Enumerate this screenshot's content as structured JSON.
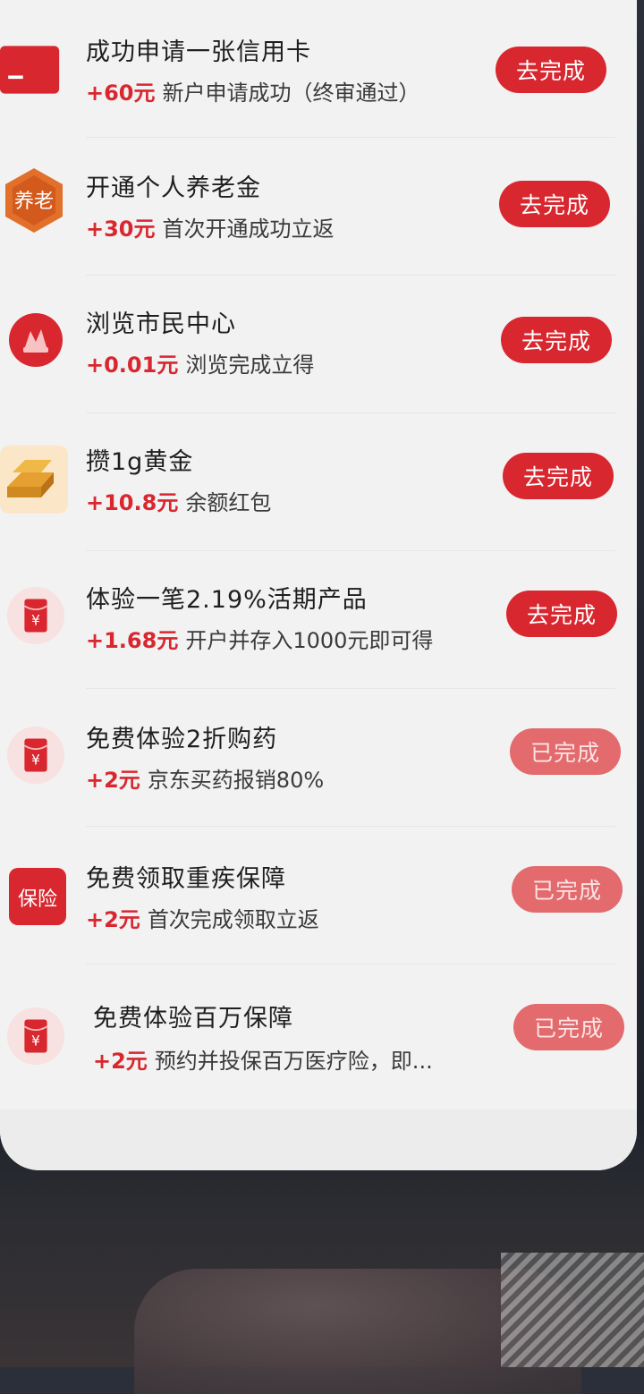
{
  "tasks": [
    {
      "title": "成功申请一张信用卡",
      "reward": "+60元",
      "desc": "新户申请成功（终审通过）",
      "action": "去完成",
      "done": false,
      "icon": "credit-card-icon"
    },
    {
      "title": "开通个人养老金",
      "reward": "+30元",
      "desc": "首次开通成功立返",
      "action": "去完成",
      "done": false,
      "icon": "pension-icon",
      "icon_text": "养老"
    },
    {
      "title": "浏览市民中心",
      "reward": "+0.01元",
      "desc": "浏览完成立得",
      "action": "去完成",
      "done": false,
      "icon": "citizen-center-icon"
    },
    {
      "title": "攒1g黄金",
      "reward": "+10.8元",
      "desc": "余额红包",
      "action": "去完成",
      "done": false,
      "icon": "gold-bar-icon"
    },
    {
      "title": "体验一笔2.19%活期产品",
      "reward": "+1.68元",
      "desc": "开户并存入1000元即可得",
      "action": "去完成",
      "done": false,
      "icon": "red-envelope-icon"
    },
    {
      "title": "免费体验2折购药",
      "reward": "+2元",
      "desc": "京东买药报销80%",
      "action": "已完成",
      "done": true,
      "icon": "red-envelope-icon"
    },
    {
      "title": "免费领取重疾保障",
      "reward": "+2元",
      "desc": "首次完成领取立返",
      "action": "已完成",
      "done": true,
      "icon": "insurance-icon",
      "icon_text": "保险"
    },
    {
      "title": "免费体验百万保障",
      "reward": "+2元",
      "desc": "预约并投保百万医疗险，即...",
      "action": "已完成",
      "done": true,
      "icon": "red-envelope-icon"
    }
  ],
  "colors": {
    "accent": "#d8272f",
    "done": "#e36a6d",
    "background": "#f2f2f2"
  }
}
